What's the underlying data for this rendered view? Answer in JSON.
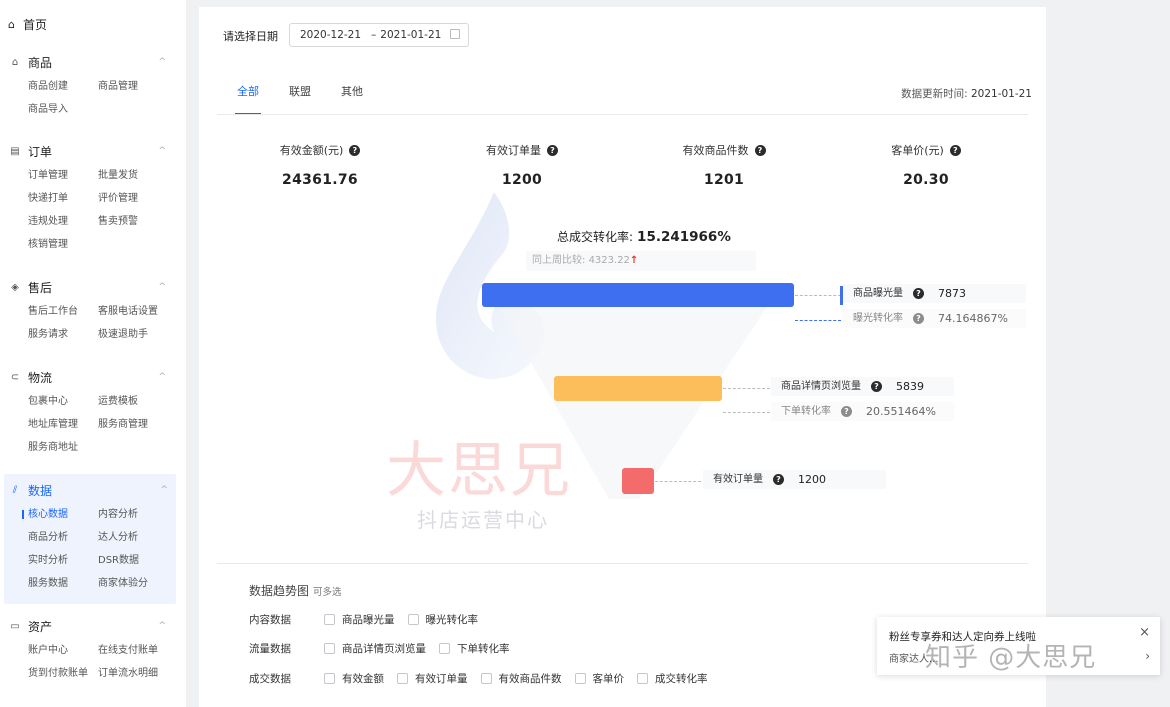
{
  "sidebar": {
    "home": {
      "icon": "home-icon",
      "label": "首页"
    },
    "groups": [
      {
        "key": "goods",
        "icon": "shopping-bag-icon",
        "label": "商品",
        "items": [
          "商品创建",
          "商品管理",
          "商品导入"
        ]
      },
      {
        "key": "orders",
        "icon": "document-icon",
        "label": "订单",
        "items": [
          "订单管理",
          "批量发货",
          "快递打单",
          "评价管理",
          "违规处理",
          "售卖预警",
          "核销管理"
        ]
      },
      {
        "key": "aftersale",
        "icon": "box-icon",
        "label": "售后",
        "items": [
          "售后工作台",
          "客服电话设置",
          "服务请求",
          "极速退助手"
        ]
      },
      {
        "key": "logistics",
        "icon": "truck-icon",
        "label": "物流",
        "items": [
          "包裹中心",
          "运费模板",
          "地址库管理",
          "服务商管理",
          "服务商地址"
        ]
      },
      {
        "key": "data",
        "icon": "chart-icon",
        "label": "数据",
        "active": true,
        "current_item": "核心数据",
        "items": [
          "核心数据",
          "内容分析",
          "商品分析",
          "达人分析",
          "实时分析",
          "DSR数据",
          "服务数据",
          "商家体验分"
        ]
      },
      {
        "key": "assets",
        "icon": "wallet-icon",
        "label": "资产",
        "items": [
          "账户中心",
          "在线支付账单",
          "货到付款账单",
          "订单流水明细"
        ]
      }
    ]
  },
  "filter": {
    "label": "请选择日期",
    "start": "2020-12-21",
    "separator": "–",
    "end": "2021-01-21"
  },
  "tabs": {
    "items": [
      "全部",
      "联盟",
      "其他"
    ],
    "active": "全部"
  },
  "update_time": {
    "label": "数据更新时间:",
    "value": "2021-01-21"
  },
  "metrics": [
    {
      "label": "有效金额(元)",
      "value": "24361.76"
    },
    {
      "label": "有效订单量",
      "value": "1200"
    },
    {
      "label": "有效商品件数",
      "value": "1201"
    },
    {
      "label": "客单价(元)",
      "value": "20.30"
    }
  ],
  "conversion": {
    "label": "总成交转化率:",
    "value": "15.241966%",
    "compare_label": "同上周比较:",
    "compare_value": "4323.22",
    "compare_arrow": "↑"
  },
  "funnel": {
    "colors": {
      "stage1": "#3d6ff0",
      "stage2": "#fcbd5b",
      "stage3": "#f46b6b"
    },
    "stages": [
      {
        "label": "商品曝光量",
        "value": "7873",
        "rate_label": "曝光转化率",
        "rate": "74.164867%"
      },
      {
        "label": "商品详情页浏览量",
        "value": "5839",
        "rate_label": "下单转化率",
        "rate": "20.551464%"
      },
      {
        "label": "有效订单量",
        "value": "1200"
      }
    ]
  },
  "watermark": {
    "big": "大思兄",
    "small": "抖店运营中心"
  },
  "trend": {
    "title": "数据趋势图",
    "hint": "可多选",
    "rows": [
      {
        "label": "内容数据",
        "options": [
          "商品曝光量",
          "曝光转化率"
        ]
      },
      {
        "label": "流量数据",
        "options": [
          "商品详情页浏览量",
          "下单转化率"
        ]
      },
      {
        "label": "成交数据",
        "options": [
          "有效金额",
          "有效订单量",
          "有效商品件数",
          "客单价",
          "成交转化率"
        ]
      }
    ]
  },
  "toast": {
    "title": "粉丝专享券和达人定向券上线啦",
    "body": "商家达人...",
    "watermark": "知乎 @大思兄",
    "close": "×",
    "more": "›"
  }
}
